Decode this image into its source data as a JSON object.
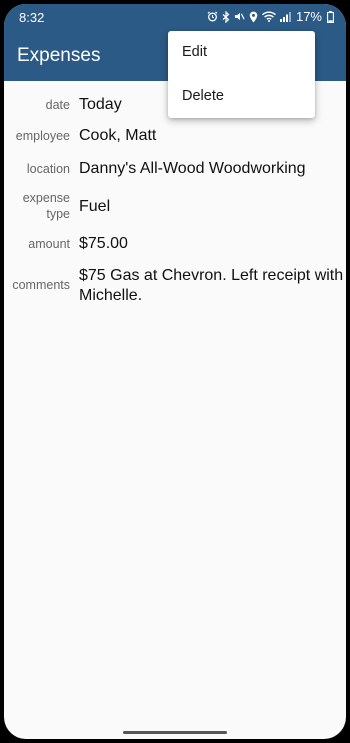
{
  "status_bar": {
    "time": "8:32",
    "battery_percent": "17%",
    "icons": [
      "alarm-icon",
      "bluetooth-icon",
      "mute-icon",
      "location-icon",
      "wifi-icon",
      "signal-icon",
      "battery-icon"
    ]
  },
  "app_bar": {
    "title": "Expenses"
  },
  "menu": {
    "items": [
      {
        "label": "Edit"
      },
      {
        "label": "Delete"
      }
    ]
  },
  "fields": [
    {
      "label_line1": "date",
      "label_line2": "",
      "value": "Today"
    },
    {
      "label_line1": "employee",
      "label_line2": "",
      "value": "Cook, Matt"
    },
    {
      "label_line1": "location",
      "label_line2": "",
      "value": "Danny's All-Wood Woodworking"
    },
    {
      "label_line1": "expense",
      "label_line2": "type",
      "value": "Fuel"
    },
    {
      "label_line1": "amount",
      "label_line2": "",
      "value": "$75.00"
    },
    {
      "label_line1": "comments",
      "label_line2": "",
      "value": "$75 Gas at Chevron. Left receipt with Michelle."
    }
  ],
  "colors": {
    "primary": "#2b5a86",
    "background": "#fafafa",
    "label_text": "#666666",
    "value_text": "#111111"
  }
}
